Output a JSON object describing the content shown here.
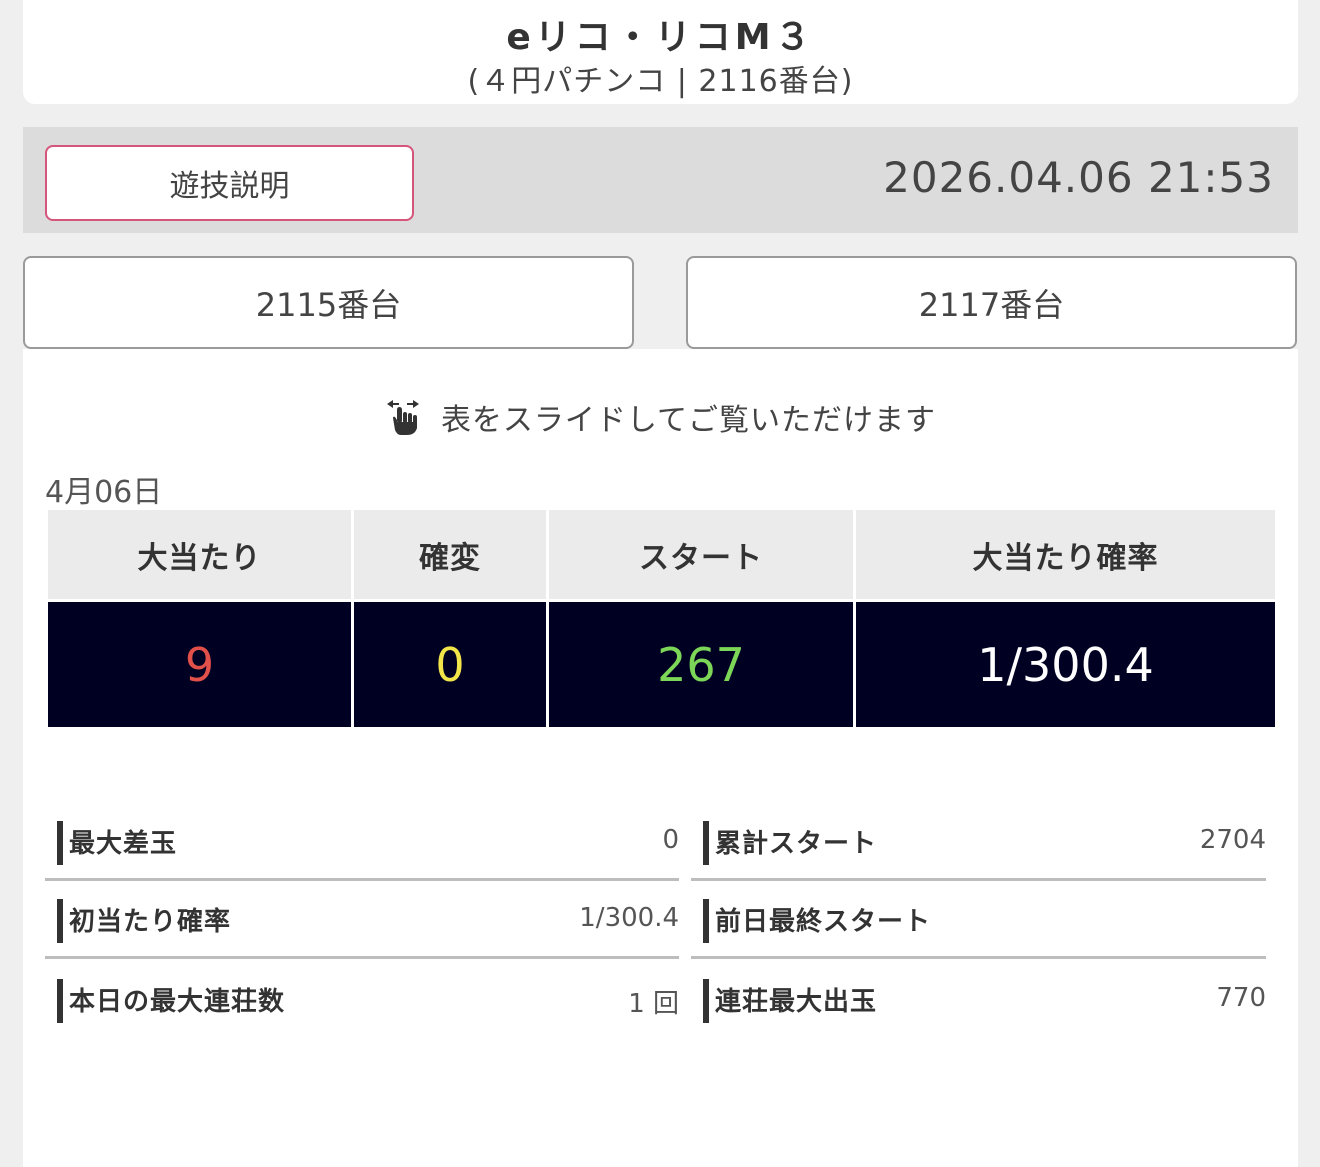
{
  "header": {
    "title": "eリコ・リコM３",
    "subtitle": "(４円パチンコ | 2116番台)"
  },
  "info_bar": {
    "help_button": "遊技説明",
    "datetime": "2026.04.06 21:53"
  },
  "navigation": {
    "prev_label": "2115番台",
    "next_label": "2117番台"
  },
  "slide_hint": {
    "icon": "swipe-hand-icon",
    "text": "表をスライドしてご覧いただけます"
  },
  "date_label": "4月06日",
  "stats_table": {
    "headers": [
      "大当たり",
      "確変",
      "スタート",
      "大当たり確率"
    ],
    "values": [
      "9",
      "0",
      "267",
      "1/300.4"
    ],
    "value_colors": [
      "#e2504a",
      "#f1e54a",
      "#7cd657",
      "#ffffff"
    ]
  },
  "details": [
    {
      "label": "最大差玉",
      "value": "0"
    },
    {
      "label": "累計スタート",
      "value": "2704"
    },
    {
      "label": "初当たり確率",
      "value": "1/300.4"
    },
    {
      "label": "前日最終スタート",
      "value": ""
    },
    {
      "label": "本日の最大連荘数",
      "value": "1 回"
    },
    {
      "label": "連荘最大出玉",
      "value": "770"
    }
  ]
}
